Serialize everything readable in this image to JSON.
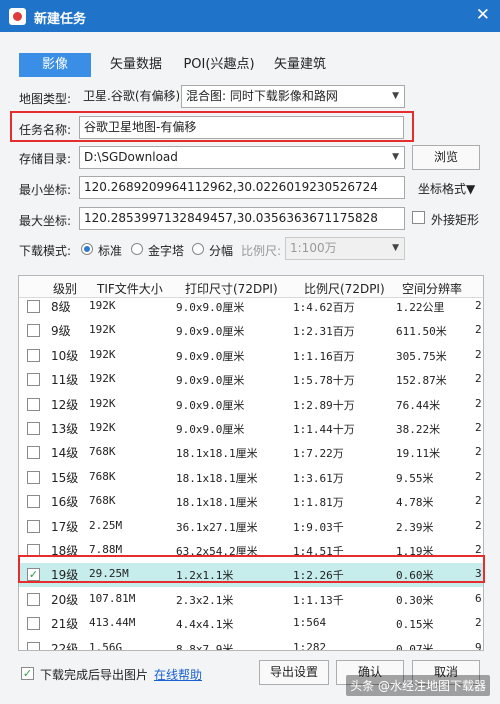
{
  "window": {
    "title": "新建任务",
    "close": "✕"
  },
  "tabs": [
    {
      "label": "影像",
      "active": true
    },
    {
      "label": "矢量数据",
      "active": false
    },
    {
      "label": "POI(兴趣点)",
      "active": false
    },
    {
      "label": "矢量建筑",
      "active": false
    }
  ],
  "form": {
    "map_type_label": "地图类型:",
    "map_type_value": "卫星.谷歌(有偏移)",
    "mix_value": "混合图: 同时下载影像和路网",
    "task_name_label": "任务名称:",
    "task_name_value": "谷歌卫星地图-有偏移",
    "save_dir_label": "存储目录:",
    "save_dir_value": "D:\\SGDownload",
    "browse_label": "浏览",
    "min_coord_label": "最小坐标:",
    "min_coord_value": "120.2689209964112962,30.0226019230526724",
    "coord_format_label": "坐标格式▼",
    "max_coord_label": "最大坐标:",
    "max_coord_value": "120.2853997132849457,30.0356363671175828",
    "outer_rect_label": "外接矩形",
    "download_mode_label": "下载模式:",
    "mode_standard": "标准",
    "mode_pyramid": "金字塔",
    "mode_tiled": "分幅",
    "scale_label": "比例尺:",
    "scale_value": "1:100万"
  },
  "table": {
    "headers": [
      "级别",
      "TIF文件大小",
      "打印尺寸(72DPI)",
      "比例尺(72DPI)",
      "空间分辨率"
    ],
    "rows": [
      {
        "level": "8级",
        "size": "192K",
        "print": "9.0x9.0厘米",
        "scale": "1:4.62百万",
        "res": "1.22公里",
        "checked": false,
        "extra": "2"
      },
      {
        "level": "9级",
        "size": "192K",
        "print": "9.0x9.0厘米",
        "scale": "1:2.31百万",
        "res": "611.50米",
        "checked": false,
        "extra": "2"
      },
      {
        "level": "10级",
        "size": "192K",
        "print": "9.0x9.0厘米",
        "scale": "1:1.16百万",
        "res": "305.75米",
        "checked": false,
        "extra": "2"
      },
      {
        "level": "11级",
        "size": "192K",
        "print": "9.0x9.0厘米",
        "scale": "1:5.78十万",
        "res": "152.87米",
        "checked": false,
        "extra": "2"
      },
      {
        "level": "12级",
        "size": "192K",
        "print": "9.0x9.0厘米",
        "scale": "1:2.89十万",
        "res": "76.44米",
        "checked": false,
        "extra": "2"
      },
      {
        "level": "13级",
        "size": "192K",
        "print": "9.0x9.0厘米",
        "scale": "1:1.44十万",
        "res": "38.22米",
        "checked": false,
        "extra": "2"
      },
      {
        "level": "14级",
        "size": "768K",
        "print": "18.1x18.1厘米",
        "scale": "1:7.22万",
        "res": "19.11米",
        "checked": false,
        "extra": "2"
      },
      {
        "level": "15级",
        "size": "768K",
        "print": "18.1x18.1厘米",
        "scale": "1:3.61万",
        "res": "9.55米",
        "checked": false,
        "extra": "2"
      },
      {
        "level": "16级",
        "size": "768K",
        "print": "18.1x18.1厘米",
        "scale": "1:1.81万",
        "res": "4.78米",
        "checked": false,
        "extra": "2"
      },
      {
        "level": "17级",
        "size": "2.25M",
        "print": "36.1x27.1厘米",
        "scale": "1:9.03千",
        "res": "2.39米",
        "checked": false,
        "extra": "2"
      },
      {
        "level": "18级",
        "size": "7.88M",
        "print": "63.2x54.2厘米",
        "scale": "1:4.51千",
        "res": "1.19米",
        "checked": false,
        "extra": "2"
      },
      {
        "level": "19级",
        "size": "29.25M",
        "print": "1.2x1.1米",
        "scale": "1:2.26千",
        "res": "0.60米",
        "checked": true,
        "extra": "3"
      },
      {
        "level": "20级",
        "size": "107.81M",
        "print": "2.3x2.1米",
        "scale": "1:1.13千",
        "res": "0.30米",
        "checked": false,
        "extra": "6"
      },
      {
        "level": "21级",
        "size": "413.44M",
        "print": "4.4x4.1米",
        "scale": "1:564",
        "res": "0.15米",
        "checked": false,
        "extra": "2"
      },
      {
        "level": "22级",
        "size": "1.56G",
        "print": "8.8x7.9米",
        "scale": "1:282",
        "res": "0.07米",
        "checked": false,
        "extra": "9"
      }
    ]
  },
  "footer": {
    "export_after_label": "下载完成后导出图片",
    "online_help": "在线帮助",
    "export_settings": "导出设置",
    "confirm": "确认",
    "cancel": "取消"
  },
  "watermark": "头条 @水经注地图下载器",
  "colors": {
    "titlebar": "#1f74c9",
    "tab_active": "#3a8ee6",
    "highlight": "#e52d2d",
    "selected_row": "#c7ecec"
  }
}
